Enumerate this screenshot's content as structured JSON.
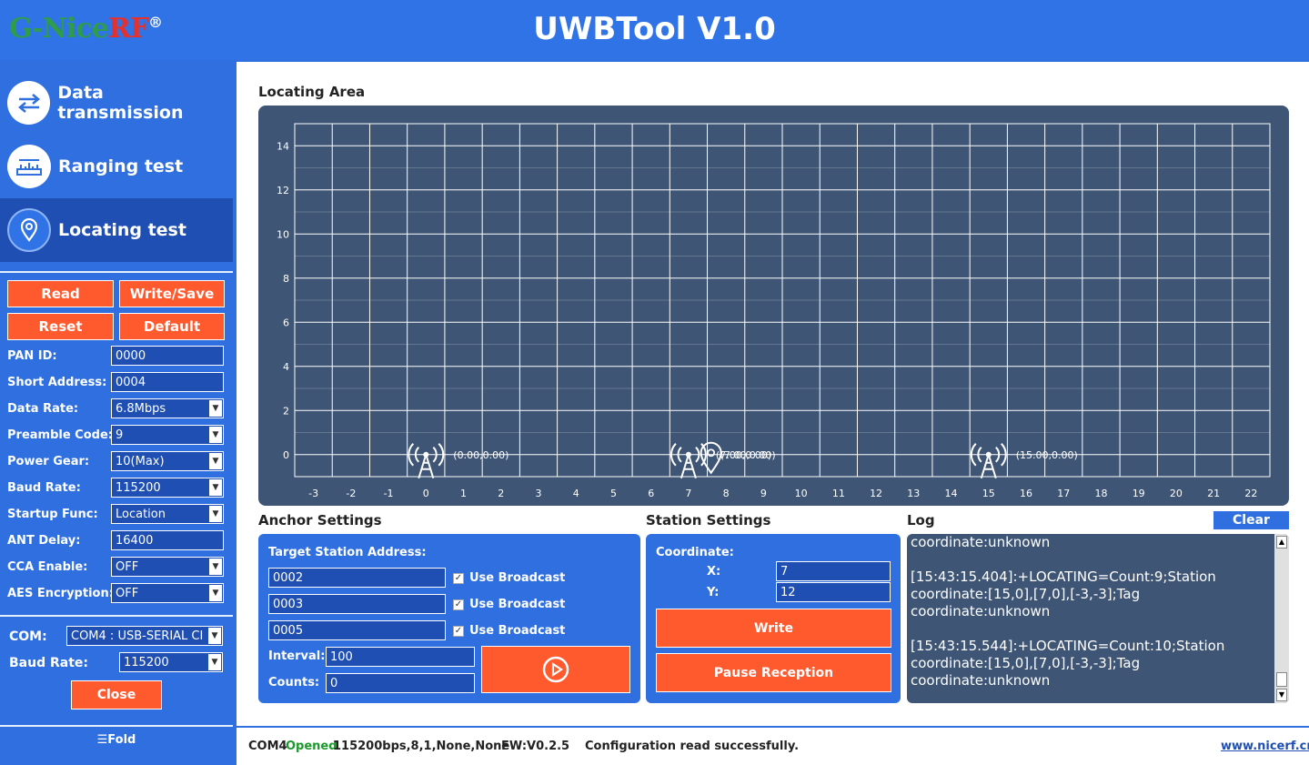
{
  "header": {
    "logo_main": "G-Nice",
    "logo_rf": "RF",
    "logo_reg": "®",
    "title": "UWBTool V1.0"
  },
  "nav": [
    {
      "label": "Data transmission",
      "icon": "transfer-arrows-icon"
    },
    {
      "label": "Ranging test",
      "icon": "ruler-icon"
    },
    {
      "label": "Locating test",
      "icon": "location-pin-icon"
    }
  ],
  "config": {
    "read": "Read",
    "write_save": "Write/Save",
    "reset": "Reset",
    "default": "Default",
    "fields": [
      {
        "label": "PAN ID:",
        "value": "0000",
        "dropdown": false
      },
      {
        "label": "Short Address:",
        "value": "0004",
        "dropdown": false
      },
      {
        "label": "Data Rate:",
        "value": "6.8Mbps",
        "dropdown": true
      },
      {
        "label": "Preamble Code:",
        "value": "9",
        "dropdown": true
      },
      {
        "label": "Power Gear:",
        "value": "10(Max)",
        "dropdown": true
      },
      {
        "label": "Baud Rate:",
        "value": "115200",
        "dropdown": true
      },
      {
        "label": "Startup Func:",
        "value": "Location",
        "dropdown": true
      },
      {
        "label": "ANT Delay:",
        "value": "16400",
        "dropdown": false
      },
      {
        "label": "CCA Enable:",
        "value": "OFF",
        "dropdown": true
      },
      {
        "label": "AES Encryption:",
        "value": "OFF",
        "dropdown": true
      }
    ]
  },
  "serial": {
    "com_label": "COM:",
    "com_value": "COM4 : USB-SERIAL CI",
    "baud_label": "Baud Rate:",
    "baud_value": "115200",
    "close": "Close"
  },
  "fold": "Fold",
  "locating": {
    "title": "Locating Area",
    "anchors": [
      {
        "x": 0,
        "y": 0,
        "label": "(0.00,0.00)"
      },
      {
        "x": 7,
        "y": 0,
        "label": "(7.00,0.00)"
      },
      {
        "x": 15,
        "y": 0,
        "label": "(15.00,0.00)"
      }
    ],
    "tag_overlap_label": "(7.00,0.00)"
  },
  "chart_data": {
    "type": "scatter",
    "xlim": [
      -3.5,
      22.5
    ],
    "ylim": [
      -1,
      15
    ],
    "x_ticks": [
      -3,
      -2,
      -1,
      0,
      1,
      2,
      3,
      4,
      5,
      6,
      7,
      8,
      9,
      10,
      11,
      12,
      13,
      14,
      15,
      16,
      17,
      18,
      19,
      20,
      21,
      22
    ],
    "y_ticks": [
      0,
      2,
      4,
      6,
      8,
      10,
      12,
      14
    ],
    "grid": true,
    "series": [
      {
        "points": [
          [
            0,
            0
          ],
          [
            7,
            0
          ],
          [
            15,
            0
          ]
        ]
      },
      {
        "points": [
          [
            7.6,
            0
          ]
        ]
      }
    ]
  },
  "anchor_settings": {
    "title": "Anchor Settings",
    "target_label": "Target Station Address:",
    "addresses": [
      "0002",
      "0003",
      "0005"
    ],
    "broadcast_label": "Use Broadcast",
    "interval_label": "Interval:",
    "interval_value": "100",
    "counts_label": "Counts:",
    "counts_value": "0"
  },
  "station_settings": {
    "title": "Station Settings",
    "coord_label": "Coordinate:",
    "x_label": "X:",
    "x_value": "7",
    "y_label": "Y:",
    "y_value": "12",
    "write": "Write",
    "pause": "Pause Reception"
  },
  "log": {
    "title": "Log",
    "clear": "Clear",
    "text": "coordinate:unknown\n\n[15:43:15.404]:+LOCATING=Count:9;Station coordinate:[15,0],[7,0],[-3,-3];Tag coordinate:unknown\n\n[15:43:15.544]:+LOCATING=Count:10;Station coordinate:[15,0],[7,0],[-3,-3];Tag coordinate:unknown"
  },
  "status": {
    "com": "COM4",
    "opened": "Opened",
    "params": "115200bps,8,1,None,None",
    "fw": "FW:V0.2.5",
    "message": "Configuration read successfully.",
    "link": "www.nicerf.cn"
  },
  "colors": {
    "accent": "#2f6fe0",
    "button": "#ff5a2e",
    "chart_bg": "#3e5575",
    "opened": "#1a9a2a"
  }
}
